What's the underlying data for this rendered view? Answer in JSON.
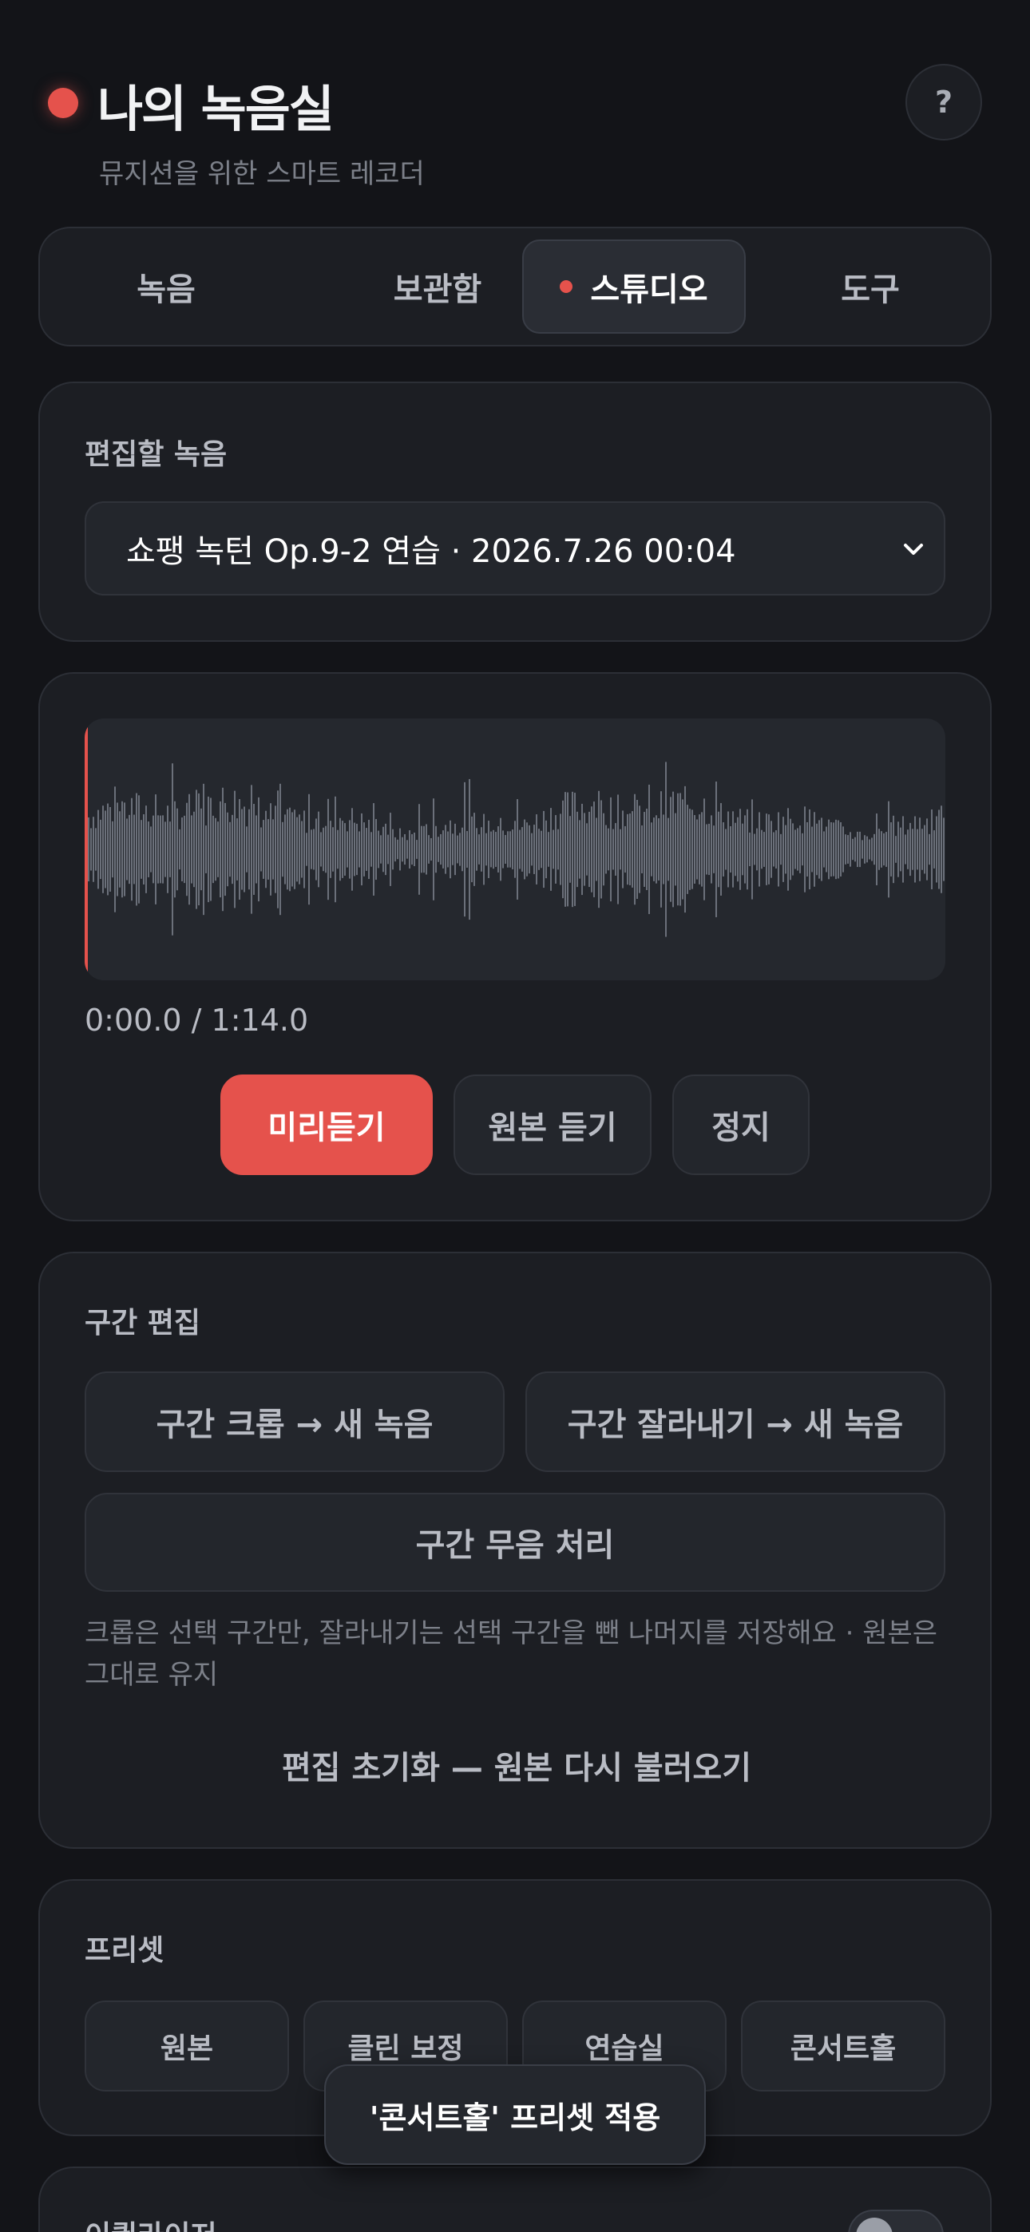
{
  "header": {
    "title": "나의 녹음실",
    "subtitle": "뮤지션을 위한 스마트 레코더",
    "help_label": "?"
  },
  "tabs": [
    {
      "label": "녹음",
      "active": false
    },
    {
      "label": "보관함",
      "active": false
    },
    {
      "label": "스튜디오",
      "active": true
    },
    {
      "label": "도구",
      "active": false
    }
  ],
  "edit_recording": {
    "label": "편집할 녹음",
    "selected": "쇼팽 녹턴 Op.9-2 연습 · 2026.7.26 00:04"
  },
  "player": {
    "time": "0:00.0 / 1:14.0",
    "preview_label": "미리듣기",
    "original_label": "원본 듣기",
    "stop_label": "정지",
    "progress": 0
  },
  "section_edit": {
    "label": "구간 편집",
    "crop_label": "구간 크롭 → 새 녹음",
    "cut_label": "구간 잘라내기 → 새 녹음",
    "mute_label": "구간 무음 처리",
    "hint": "크롭은 선택 구간만, 잘라내기는 선택 구간을 뺀 나머지를 저장해요 · 원본은 그대로 유지",
    "reset_label": "편집 초기화 — 원본 다시 불러오기"
  },
  "presets": {
    "label": "프리셋",
    "items": [
      "원본",
      "클린 보정",
      "연습실",
      "콘서트홀"
    ]
  },
  "toast": "'콘서트홀' 프리셋 적용",
  "next_section": {
    "title": "이퀄라이저",
    "toggle_on": false
  },
  "colors": {
    "accent": "#e5524c",
    "background": "#131418",
    "card": "#1c1e23",
    "waveform": "#6b707a"
  }
}
